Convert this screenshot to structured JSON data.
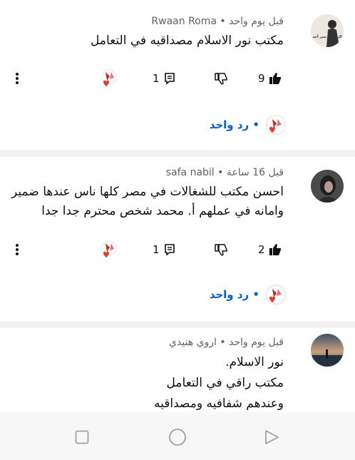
{
  "comments": [
    {
      "author": "Rwaan Roma",
      "time": "قبل يوم واحد",
      "lines": [
        "مكتب نور الاسلام  مصداقيه في التعامل"
      ],
      "likes": "9",
      "replies": "1",
      "reply_label": "• رد واحد"
    },
    {
      "author": "safa nabil",
      "time": "قبل 16 ساعة",
      "lines": [
        "احسن مكتب للشغالات في مصر  كلها ناس عندها ضمير",
        "وامانه في عملهم أ. محمد شخص محترم جدا  جدا"
      ],
      "likes": "2",
      "replies": "1",
      "reply_label": "• رد واحد"
    },
    {
      "author": "اروي هنيدي",
      "time": "قبل يوم واحد",
      "lines": [
        "نور الاسلام.",
        "مكتب راقي في التعامل",
        "وعندهم شفافيه ومصداقيه"
      ]
    }
  ],
  "separator": " • ",
  "avatar_texts": {
    "c1": "الزمن لا يغير أحد"
  },
  "colors": {
    "link": "#065fd4",
    "heart": "#e53935",
    "meta": "#606060"
  },
  "icons": [
    "more-vert-icon",
    "heart-avatar-icon",
    "reply-icon",
    "dislike-icon",
    "like-icon",
    "nav-square-icon",
    "nav-circle-icon",
    "nav-triangle-icon"
  ]
}
